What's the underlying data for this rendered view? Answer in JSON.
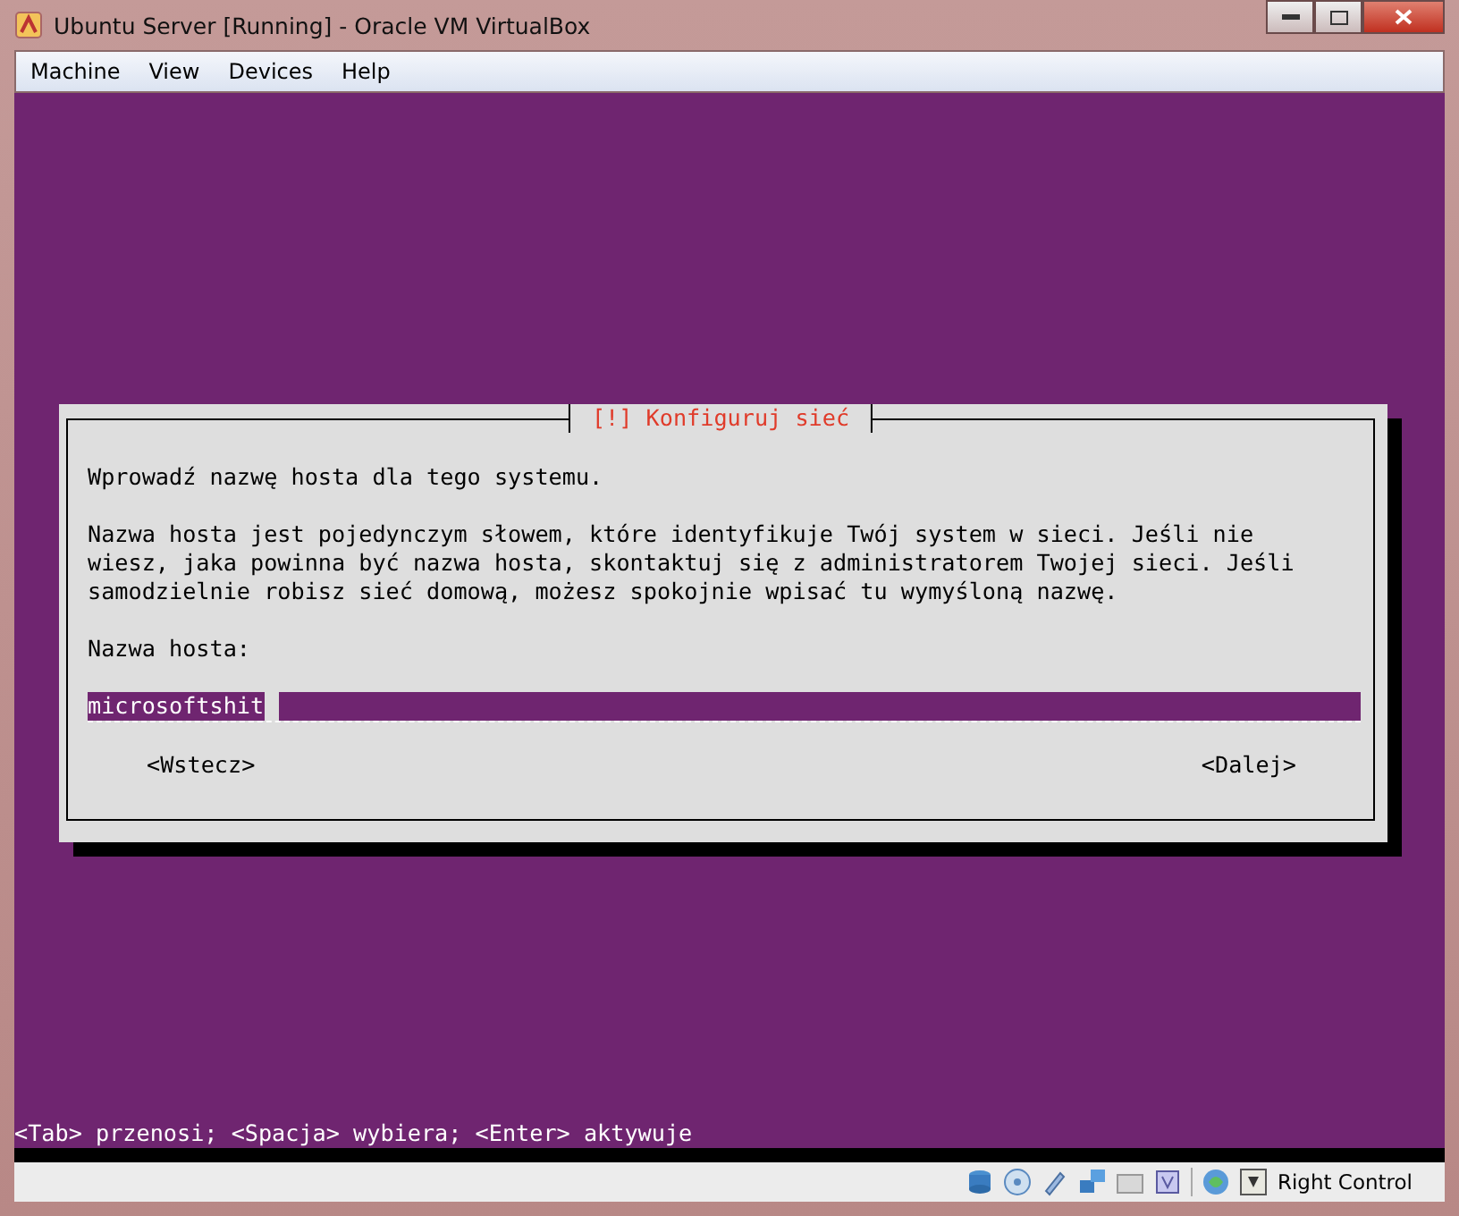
{
  "window": {
    "title": "Ubuntu Server [Running] - Oracle VM VirtualBox"
  },
  "menu": [
    "Machine",
    "View",
    "Devices",
    "Help"
  ],
  "dialog": {
    "title": "[!] Konfiguruj sieć",
    "prompt": "Wprowadź nazwę hosta dla tego systemu.",
    "description": [
      "Nazwa hosta jest pojedynczym słowem, które identyfikuje Twój system w sieci. Jeśli nie",
      "wiesz, jaka powinna być nazwa hosta, skontaktuj się z administratorem Twojej sieci. Jeśli",
      "samodzielnie robisz sieć domową, możesz spokojnie wpisać tu wymyśloną nazwę."
    ],
    "field_label": "Nazwa hosta:",
    "hostname": "microsoftshit",
    "buttons": [
      "<Wstecz>",
      "<Dalej>"
    ]
  },
  "help_line": "<Tab> przenosi; <Spacja> wybiera; <Enter> aktywuje",
  "status_bar": {
    "host_key": "Right Control"
  }
}
